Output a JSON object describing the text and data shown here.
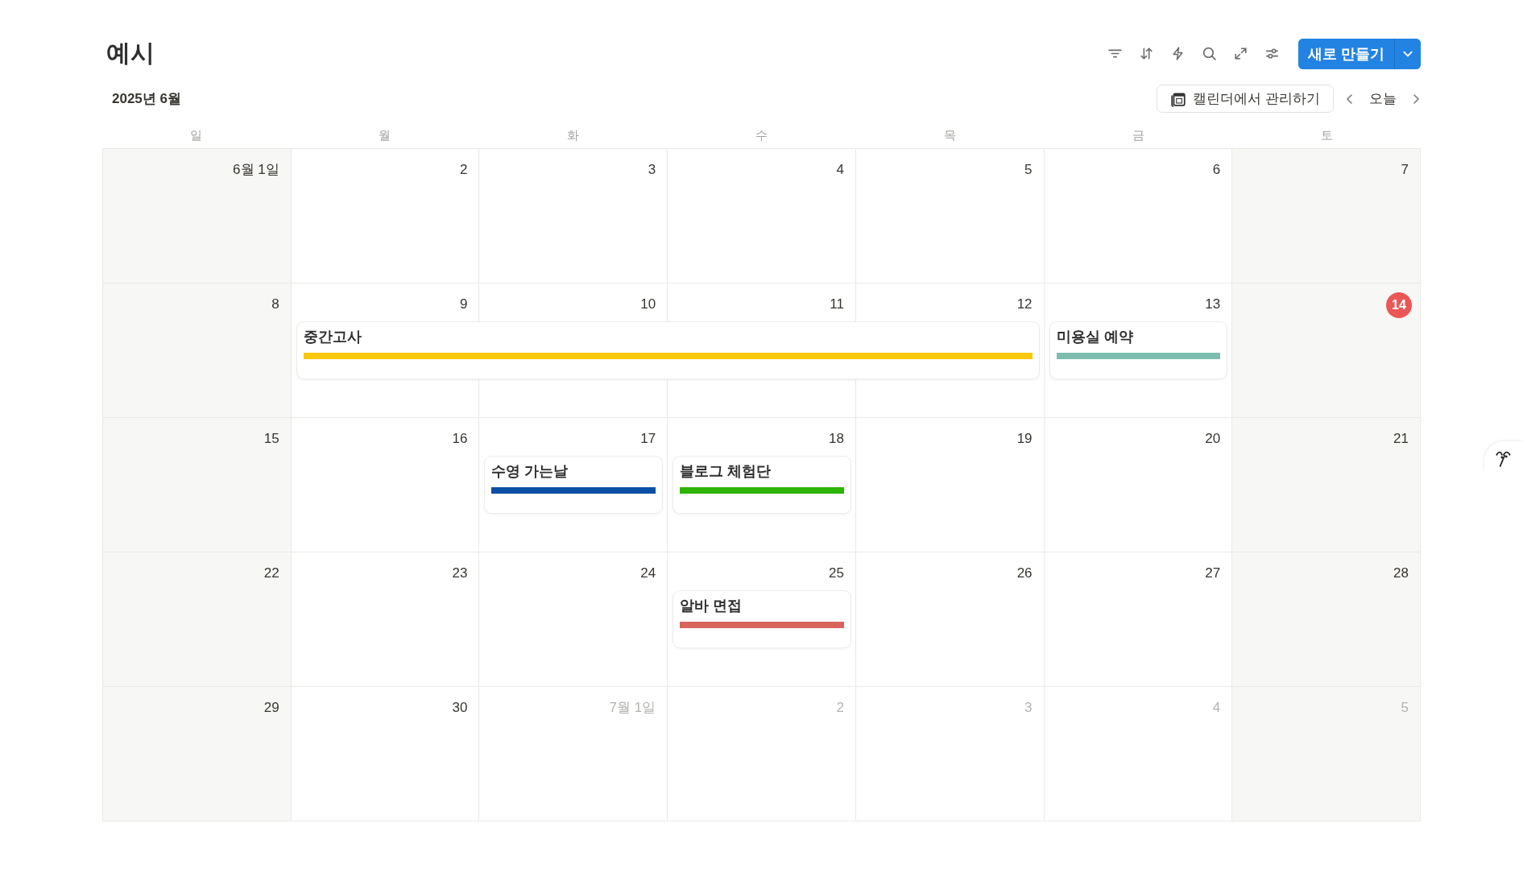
{
  "title": "예시",
  "month_label": "2025년 6월",
  "new_button": {
    "label": "새로 만들기"
  },
  "manage_button": {
    "label": "캘린더에서 관리하기"
  },
  "today_button": {
    "label": "오늘"
  },
  "weekdays": [
    "일",
    "월",
    "화",
    "수",
    "목",
    "금",
    "토"
  ],
  "weeks": [
    {
      "days": [
        {
          "label": "6월 1일",
          "muted": false,
          "today": false
        },
        {
          "label": "2",
          "muted": false,
          "today": false
        },
        {
          "label": "3",
          "muted": false,
          "today": false
        },
        {
          "label": "4",
          "muted": false,
          "today": false
        },
        {
          "label": "5",
          "muted": false,
          "today": false
        },
        {
          "label": "6",
          "muted": false,
          "today": false
        },
        {
          "label": "7",
          "muted": false,
          "today": false
        }
      ]
    },
    {
      "days": [
        {
          "label": "8",
          "muted": false,
          "today": false
        },
        {
          "label": "9",
          "muted": false,
          "today": false,
          "events": [
            {
              "title": "중간고사",
              "color": "#f9c80e"
            }
          ]
        },
        {
          "label": "10",
          "muted": false,
          "today": false,
          "event_continues": true
        },
        {
          "label": "11",
          "muted": false,
          "today": false,
          "event_continues": true
        },
        {
          "label": "12",
          "muted": false,
          "today": false,
          "event_continues": true
        },
        {
          "label": "13",
          "muted": false,
          "today": false,
          "events": [
            {
              "title": "미용실 예약",
              "color": "#7dbdad"
            }
          ]
        },
        {
          "label": "14",
          "muted": false,
          "today": true
        }
      ]
    },
    {
      "days": [
        {
          "label": "15",
          "muted": false,
          "today": false
        },
        {
          "label": "16",
          "muted": false,
          "today": false
        },
        {
          "label": "17",
          "muted": false,
          "today": false,
          "events": [
            {
              "title": "수영 가는날",
              "color": "#0b4fa3"
            }
          ]
        },
        {
          "label": "18",
          "muted": false,
          "today": false,
          "events": [
            {
              "title": "블로그 체험단",
              "color": "#2db300"
            }
          ]
        },
        {
          "label": "19",
          "muted": false,
          "today": false
        },
        {
          "label": "20",
          "muted": false,
          "today": false
        },
        {
          "label": "21",
          "muted": false,
          "today": false
        }
      ]
    },
    {
      "days": [
        {
          "label": "22",
          "muted": false,
          "today": false
        },
        {
          "label": "23",
          "muted": false,
          "today": false
        },
        {
          "label": "24",
          "muted": false,
          "today": false
        },
        {
          "label": "25",
          "muted": false,
          "today": false,
          "events": [
            {
              "title": "알바 면접",
              "color": "#d9645a"
            }
          ]
        },
        {
          "label": "26",
          "muted": false,
          "today": false
        },
        {
          "label": "27",
          "muted": false,
          "today": false
        },
        {
          "label": "28",
          "muted": false,
          "today": false
        }
      ]
    },
    {
      "days": [
        {
          "label": "29",
          "muted": false,
          "today": false
        },
        {
          "label": "30",
          "muted": false,
          "today": false
        },
        {
          "label": "7월 1일",
          "muted": true,
          "today": false
        },
        {
          "label": "2",
          "muted": true,
          "today": false
        },
        {
          "label": "3",
          "muted": true,
          "today": false
        },
        {
          "label": "4",
          "muted": true,
          "today": false
        },
        {
          "label": "5",
          "muted": true,
          "today": false
        }
      ]
    }
  ]
}
